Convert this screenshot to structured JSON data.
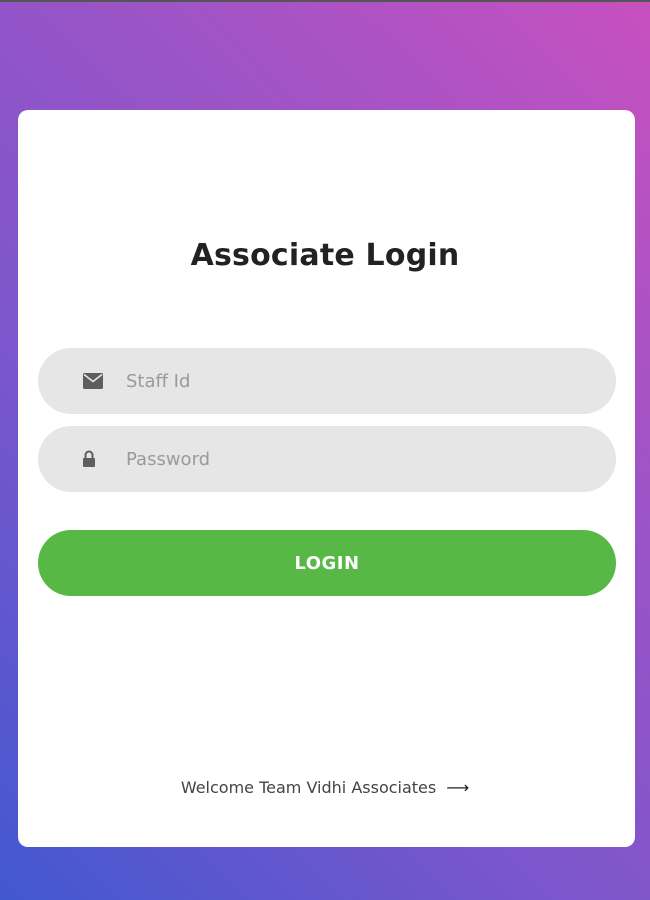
{
  "login": {
    "title": "Associate Login",
    "staff_id": {
      "placeholder": "Staff Id",
      "value": "",
      "icon": "envelope-icon"
    },
    "password": {
      "placeholder": "Password",
      "value": "",
      "icon": "lock-icon"
    },
    "login_button": "LOGIN",
    "welcome_link": "Welcome Team Vidhi Associates",
    "welcome_arrow": "⟶"
  },
  "colors": {
    "gradient_start": "#c850c0",
    "gradient_end": "#4158d0",
    "card": "#ffffff",
    "field_bg": "#e6e6e6",
    "button": "#57b846"
  }
}
